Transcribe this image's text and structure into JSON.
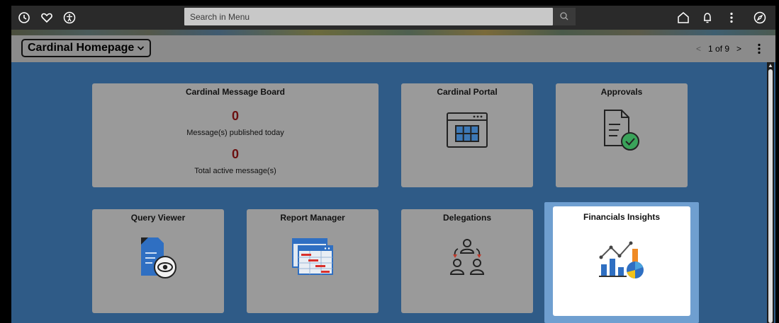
{
  "topbar": {
    "icons": [
      "recent-history-icon",
      "favorites-icon",
      "accessibility-icon",
      "home-icon",
      "notifications-icon",
      "actions-menu-icon",
      "navigator-icon"
    ],
    "search_placeholder": "Search in Menu"
  },
  "header": {
    "homepage_title": "Cardinal Homepage",
    "pager": {
      "current": "1 of 9"
    }
  },
  "tiles": {
    "message_board": {
      "title": "Cardinal Message Board",
      "published_count": "0",
      "published_label": "Message(s) published today",
      "active_count": "0",
      "active_label": "Total active message(s)"
    },
    "portal": {
      "title": "Cardinal Portal"
    },
    "approvals": {
      "title": "Approvals"
    },
    "query_viewer": {
      "title": "Query Viewer"
    },
    "report_manager": {
      "title": "Report Manager"
    },
    "delegations": {
      "title": "Delegations"
    },
    "financials_insights": {
      "title": "Financials Insights"
    }
  },
  "colors": {
    "background": "#2f5b87",
    "tile": "#9a9a9a",
    "count": "#6b0f0f",
    "focus": "#6f9fd0"
  }
}
